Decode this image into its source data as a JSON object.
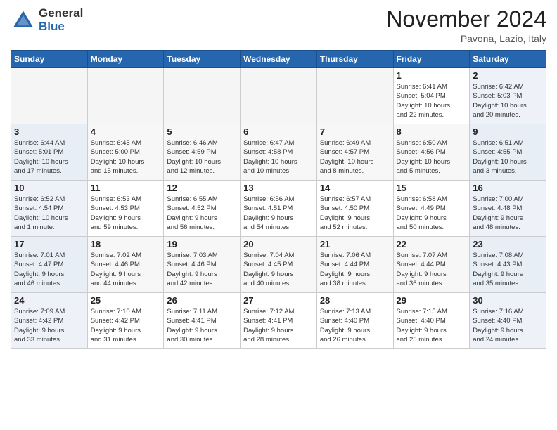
{
  "header": {
    "logo_general": "General",
    "logo_blue": "Blue",
    "month_title": "November 2024",
    "location": "Pavona, Lazio, Italy"
  },
  "columns": [
    "Sunday",
    "Monday",
    "Tuesday",
    "Wednesday",
    "Thursday",
    "Friday",
    "Saturday"
  ],
  "weeks": [
    [
      {
        "day": "",
        "info": ""
      },
      {
        "day": "",
        "info": ""
      },
      {
        "day": "",
        "info": ""
      },
      {
        "day": "",
        "info": ""
      },
      {
        "day": "",
        "info": ""
      },
      {
        "day": "1",
        "info": "Sunrise: 6:41 AM\nSunset: 5:04 PM\nDaylight: 10 hours\nand 22 minutes."
      },
      {
        "day": "2",
        "info": "Sunrise: 6:42 AM\nSunset: 5:03 PM\nDaylight: 10 hours\nand 20 minutes."
      }
    ],
    [
      {
        "day": "3",
        "info": "Sunrise: 6:44 AM\nSunset: 5:01 PM\nDaylight: 10 hours\nand 17 minutes."
      },
      {
        "day": "4",
        "info": "Sunrise: 6:45 AM\nSunset: 5:00 PM\nDaylight: 10 hours\nand 15 minutes."
      },
      {
        "day": "5",
        "info": "Sunrise: 6:46 AM\nSunset: 4:59 PM\nDaylight: 10 hours\nand 12 minutes."
      },
      {
        "day": "6",
        "info": "Sunrise: 6:47 AM\nSunset: 4:58 PM\nDaylight: 10 hours\nand 10 minutes."
      },
      {
        "day": "7",
        "info": "Sunrise: 6:49 AM\nSunset: 4:57 PM\nDaylight: 10 hours\nand 8 minutes."
      },
      {
        "day": "8",
        "info": "Sunrise: 6:50 AM\nSunset: 4:56 PM\nDaylight: 10 hours\nand 5 minutes."
      },
      {
        "day": "9",
        "info": "Sunrise: 6:51 AM\nSunset: 4:55 PM\nDaylight: 10 hours\nand 3 minutes."
      }
    ],
    [
      {
        "day": "10",
        "info": "Sunrise: 6:52 AM\nSunset: 4:54 PM\nDaylight: 10 hours\nand 1 minute."
      },
      {
        "day": "11",
        "info": "Sunrise: 6:53 AM\nSunset: 4:53 PM\nDaylight: 9 hours\nand 59 minutes."
      },
      {
        "day": "12",
        "info": "Sunrise: 6:55 AM\nSunset: 4:52 PM\nDaylight: 9 hours\nand 56 minutes."
      },
      {
        "day": "13",
        "info": "Sunrise: 6:56 AM\nSunset: 4:51 PM\nDaylight: 9 hours\nand 54 minutes."
      },
      {
        "day": "14",
        "info": "Sunrise: 6:57 AM\nSunset: 4:50 PM\nDaylight: 9 hours\nand 52 minutes."
      },
      {
        "day": "15",
        "info": "Sunrise: 6:58 AM\nSunset: 4:49 PM\nDaylight: 9 hours\nand 50 minutes."
      },
      {
        "day": "16",
        "info": "Sunrise: 7:00 AM\nSunset: 4:48 PM\nDaylight: 9 hours\nand 48 minutes."
      }
    ],
    [
      {
        "day": "17",
        "info": "Sunrise: 7:01 AM\nSunset: 4:47 PM\nDaylight: 9 hours\nand 46 minutes."
      },
      {
        "day": "18",
        "info": "Sunrise: 7:02 AM\nSunset: 4:46 PM\nDaylight: 9 hours\nand 44 minutes."
      },
      {
        "day": "19",
        "info": "Sunrise: 7:03 AM\nSunset: 4:46 PM\nDaylight: 9 hours\nand 42 minutes."
      },
      {
        "day": "20",
        "info": "Sunrise: 7:04 AM\nSunset: 4:45 PM\nDaylight: 9 hours\nand 40 minutes."
      },
      {
        "day": "21",
        "info": "Sunrise: 7:06 AM\nSunset: 4:44 PM\nDaylight: 9 hours\nand 38 minutes."
      },
      {
        "day": "22",
        "info": "Sunrise: 7:07 AM\nSunset: 4:44 PM\nDaylight: 9 hours\nand 36 minutes."
      },
      {
        "day": "23",
        "info": "Sunrise: 7:08 AM\nSunset: 4:43 PM\nDaylight: 9 hours\nand 35 minutes."
      }
    ],
    [
      {
        "day": "24",
        "info": "Sunrise: 7:09 AM\nSunset: 4:42 PM\nDaylight: 9 hours\nand 33 minutes."
      },
      {
        "day": "25",
        "info": "Sunrise: 7:10 AM\nSunset: 4:42 PM\nDaylight: 9 hours\nand 31 minutes."
      },
      {
        "day": "26",
        "info": "Sunrise: 7:11 AM\nSunset: 4:41 PM\nDaylight: 9 hours\nand 30 minutes."
      },
      {
        "day": "27",
        "info": "Sunrise: 7:12 AM\nSunset: 4:41 PM\nDaylight: 9 hours\nand 28 minutes."
      },
      {
        "day": "28",
        "info": "Sunrise: 7:13 AM\nSunset: 4:40 PM\nDaylight: 9 hours\nand 26 minutes."
      },
      {
        "day": "29",
        "info": "Sunrise: 7:15 AM\nSunset: 4:40 PM\nDaylight: 9 hours\nand 25 minutes."
      },
      {
        "day": "30",
        "info": "Sunrise: 7:16 AM\nSunset: 4:40 PM\nDaylight: 9 hours\nand 24 minutes."
      }
    ]
  ]
}
